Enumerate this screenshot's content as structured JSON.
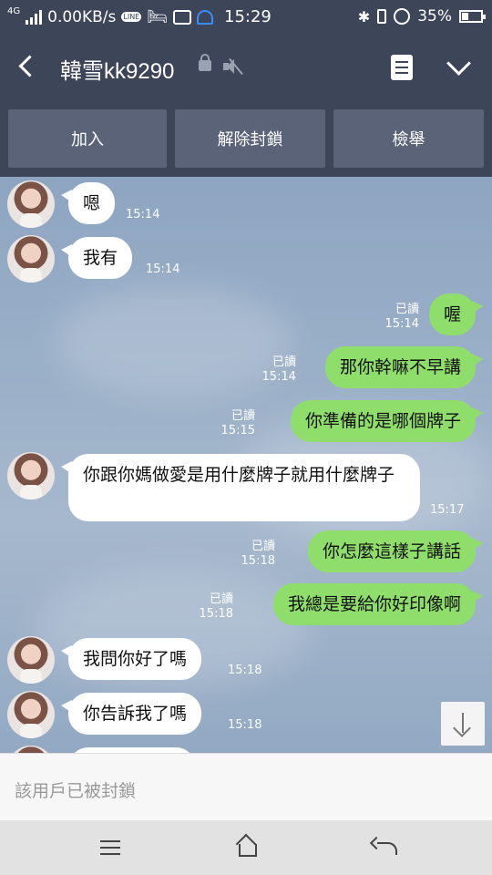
{
  "status_bar": {
    "network": "4G",
    "speed": "0.00KB/s",
    "line_label": "LINE",
    "time": "15:29",
    "battery": "35%",
    "battery_level": 0.35,
    "icons": [
      "signal-icon",
      "line-icon",
      "bed-icon",
      "image-icon",
      "headset-icon",
      "bluetooth-icon",
      "vibrate-icon",
      "alarm-icon",
      "battery-icon"
    ]
  },
  "header": {
    "title": "韓雪kk9290",
    "icons": [
      "back-icon",
      "lock-icon",
      "mute-icon",
      "notes-icon",
      "chevron-down-icon"
    ]
  },
  "actions": {
    "add": "加入",
    "unblock": "解除封鎖",
    "report": "檢舉"
  },
  "messages": [
    {
      "side": "in",
      "text": "嗯",
      "time": "15:14"
    },
    {
      "side": "in",
      "text": "我有",
      "time": "15:14"
    },
    {
      "side": "out",
      "text": "喔",
      "read": "已讀",
      "time": "15:14"
    },
    {
      "side": "out",
      "text": "那你幹嘛不早講",
      "read": "已讀",
      "time": "15:14"
    },
    {
      "side": "out",
      "text": "你準備的是哪個牌子",
      "read": "已讀",
      "time": "15:15"
    },
    {
      "side": "in",
      "text": "你跟你媽做愛是用什麼牌子就用什麼牌子",
      "time": "15:17"
    },
    {
      "side": "out",
      "text": "你怎麼這樣子講話",
      "read": "已讀",
      "time": "15:18"
    },
    {
      "side": "out",
      "text": "我總是要給你好印像啊",
      "read": "已讀",
      "time": "15:18"
    },
    {
      "side": "in",
      "text": "我問你好了嗎",
      "time": "15:18"
    },
    {
      "side": "in",
      "text": "你告訴我了嗎",
      "time": "15:18"
    }
  ],
  "blocked_notice": "該用戶已被封鎖",
  "colors": {
    "header_bg": "#3d4558",
    "action_btn_bg": "#5a6378",
    "chat_bg": "#8fa6c1",
    "outgoing_bubble": "#8fde6b",
    "incoming_bubble": "#ffffff"
  }
}
